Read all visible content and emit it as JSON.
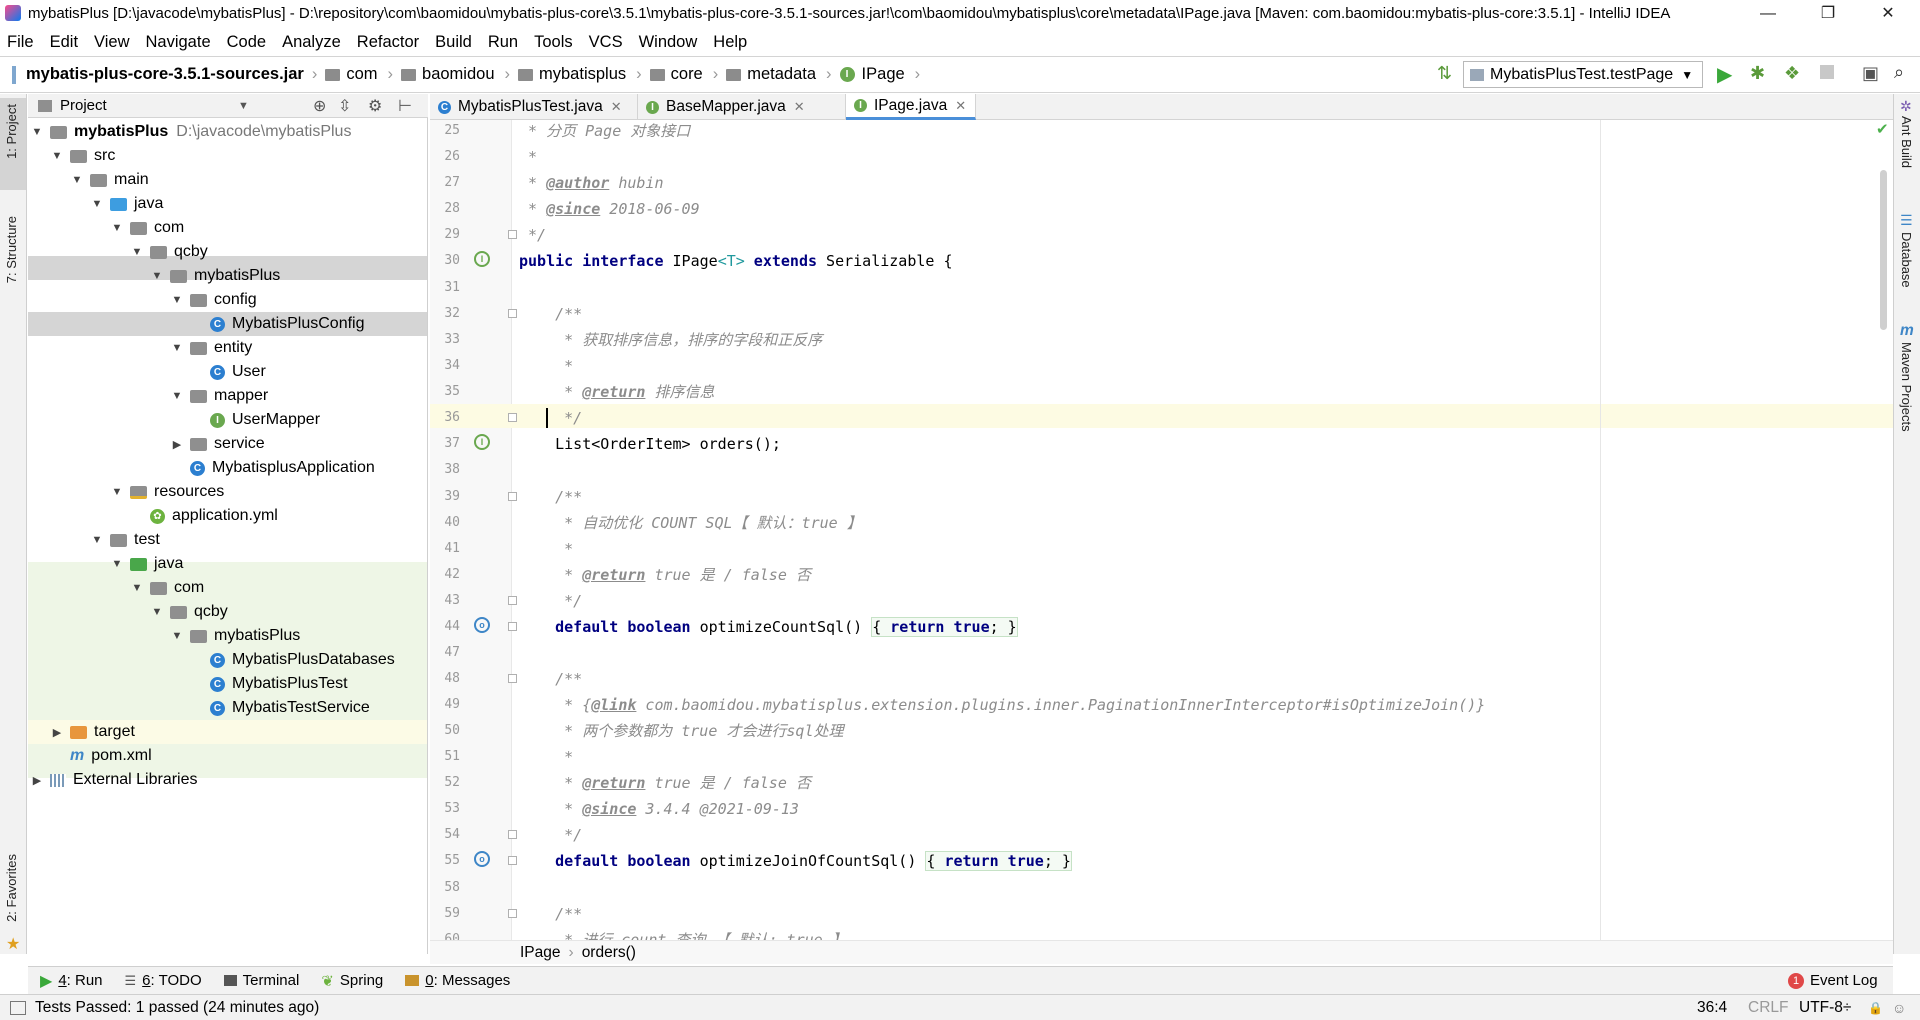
{
  "window": {
    "title": "mybatisPlus [D:\\javacode\\mybatisPlus] - D:\\repository\\com\\baomidou\\mybatis-plus-core\\3.5.1\\mybatis-plus-core-3.5.1-sources.jar!\\com\\baomidou\\mybatisplus\\core\\metadata\\IPage.java [Maven: com.baomidou:mybatis-plus-core:3.5.1] - IntelliJ IDEA",
    "minimize": "—",
    "restore": "❐",
    "close": "✕"
  },
  "menu": [
    "File",
    "Edit",
    "View",
    "Navigate",
    "Code",
    "Analyze",
    "Refactor",
    "Build",
    "Run",
    "Tools",
    "VCS",
    "Window",
    "Help"
  ],
  "nav": {
    "root": "mybatis-plus-core-3.5.1-sources.jar",
    "crumbs": [
      "com",
      "baomidou",
      "mybatisplus",
      "core",
      "metadata"
    ],
    "file": "IPage",
    "run_config": "MybatisPlusTest.testPage"
  },
  "side_tabs": {
    "project": "1: Project",
    "structure": "7: Structure",
    "favorites": "2: Favorites",
    "ant": "Ant Build",
    "database": "Database",
    "maven": "Maven Projects"
  },
  "project_panel": {
    "title": "Project",
    "root_name": "mybatisPlus",
    "root_path": "D:\\javacode\\mybatisPlus",
    "tree": [
      "src",
      "main",
      "java",
      "com",
      "qcby",
      "mybatisPlus",
      "config",
      "MybatisPlusConfig",
      "entity",
      "User",
      "mapper",
      "UserMapper",
      "service",
      "MybatisplusApplication",
      "resources",
      "application.yml",
      "test",
      "java",
      "com",
      "qcby",
      "mybatisPlus",
      "MybatisPlusDatabases",
      "MybatisPlusTest",
      "MybatisTestService",
      "target",
      "pom.xml",
      "External Libraries"
    ]
  },
  "tabs": [
    "MybatisPlusTest.java",
    "BaseMapper.java",
    "IPage.java"
  ],
  "lines": {
    "n25": "25",
    "n26": "26",
    "n27": "27",
    "n28": "28",
    "n29": "29",
    "n30": "30",
    "n31": "31",
    "n32": "32",
    "n33": "33",
    "n34": "34",
    "n35": "35",
    "n36": "36",
    "n37": "37",
    "n38": "38",
    "n39": "39",
    "n40": "40",
    "n41": "41",
    "n42": "42",
    "n43": "43",
    "n44": "44",
    "n47": "47",
    "n48": "48",
    "n49": "49",
    "n50": "50",
    "n51": "51",
    "n52": "52",
    "n53": "53",
    "n54": "54",
    "n55": "55",
    "n58": "58",
    "n59": "59",
    "n60": "60"
  },
  "code": {
    "l25": " * 分页 Page 对象接口",
    "l26": " *",
    "l27_pre": " * ",
    "l27_tag": "@author",
    "l27_val": " hubin",
    "l28_pre": " * ",
    "l28_tag": "@since",
    "l28_val": " 2018-06-09",
    "l29": " */",
    "l30_kw1": "public interface",
    "l30_name": " IPage",
    "l30_gen": "<T>",
    "l30_kw2": " extends",
    "l30_rest": " Serializable {",
    "l32": "    /**",
    "l33": "     * 获取排序信息，排序的字段和正反序",
    "l34": "     *",
    "l35_pre": "     * ",
    "l35_tag": "@return",
    "l35_val": " 排序信息",
    "l36": "     */",
    "l37": "    List<OrderItem> orders();",
    "l39": "    /**",
    "l40": "     * 自动优化 COUNT SQL【 默认：true 】",
    "l41": "     *",
    "l42_pre": "     * ",
    "l42_tag": "@return",
    "l42_val": " true 是 / false 否",
    "l43": "     */",
    "l44_kw": "    default boolean",
    "l44_name": " optimizeCountSql()",
    "l44_body_kw": "return true",
    "l44_end": ";",
    "l48": "    /**",
    "l49_pre": "     * {",
    "l49_tag": "@link",
    "l49_val": " com.baomidou.mybatisplus.extension.plugins.inner.PaginationInnerInterceptor#isOptimizeJoin()}",
    "l50": "     * 两个参数都为 true 才会进行sql处理",
    "l51": "     *",
    "l52_pre": "     * ",
    "l52_tag": "@return",
    "l52_val": " true 是 / false 否",
    "l53_pre": "     * ",
    "l53_tag": "@since",
    "l53_val": " 3.4.4 @2021-09-13",
    "l54": "     */",
    "l55_kw": "    default boolean",
    "l55_name": " optimizeJoinOfCountSql()",
    "l55_body_kw": "return true",
    "l55_end": ";",
    "l59": "    /**",
    "l60": "     * 进行 count 查询 【 默认: true 】"
  },
  "breadcrumb": {
    "cls": "IPage",
    "method": "orders()"
  },
  "tool_tabs": {
    "run_num": "4",
    "run": ": Run",
    "todo_num": "6",
    "todo": ": TODO",
    "terminal": "Terminal",
    "spring": "Spring",
    "msg_num": "0",
    "messages": ": Messages",
    "event_log": "Event Log",
    "event_count": "1"
  },
  "status": {
    "message": "Tests Passed: 1 passed (24 minutes ago)",
    "position": "36:4",
    "line_sep": "CRLF",
    "encoding": "UTF-8÷"
  },
  "colors": {
    "accent": "#2c7fd0",
    "highlight_line": "#fdfbe3",
    "test_bg": "#eef6e6",
    "selected": "#d5d5d5"
  }
}
